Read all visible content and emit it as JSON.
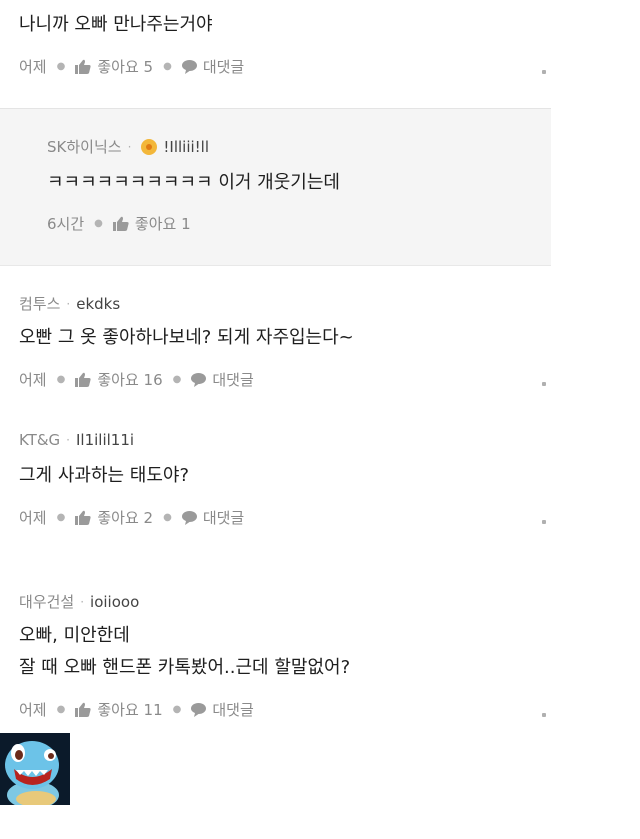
{
  "comments": [
    {
      "text": "나니까 오빠 만나주는거야",
      "date": "어제",
      "like_label": "좋아요",
      "like_count": "5",
      "reply_label": "대댓글"
    },
    {
      "author_prefix": "컴투스",
      "author_nick": "ekdks",
      "text": "오빤 그 옷 좋아하나보네? 되게 자주입는다~",
      "date": "어제",
      "like_label": "좋아요",
      "like_count": "16",
      "reply_label": "대댓글"
    },
    {
      "author_prefix": "KT&G",
      "author_nick": "Il1ilil11i",
      "text": "그게 사과하는 태도야?",
      "date": "어제",
      "like_label": "좋아요",
      "like_count": "2",
      "reply_label": "대댓글"
    },
    {
      "author_prefix": "대우건설",
      "author_nick": "ioiiooo",
      "text_line1": "오빠, 미안한데",
      "text_line2": "잘 때 오빠 핸드폰 카톡봤어..근데 할말없어?",
      "date": "어제",
      "like_label": "좋아요",
      "like_count": "11",
      "reply_label": "대댓글"
    }
  ],
  "reply": {
    "author_prefix": "SK하이닉스",
    "author_nick": "!Illiii!ll",
    "badge_icon": "medal-icon",
    "text": "ㅋㅋㅋㅋㅋㅋㅋㅋㅋㅋ 이거 개웃기는데",
    "time": "6시간",
    "like_label": "좋아요",
    "like_count": "1"
  },
  "colors": {
    "reply_background": "#f5f5f5",
    "meta_text": "#8a8a8a",
    "body_text": "#1e1e1e",
    "badge": "#f3b73a"
  }
}
